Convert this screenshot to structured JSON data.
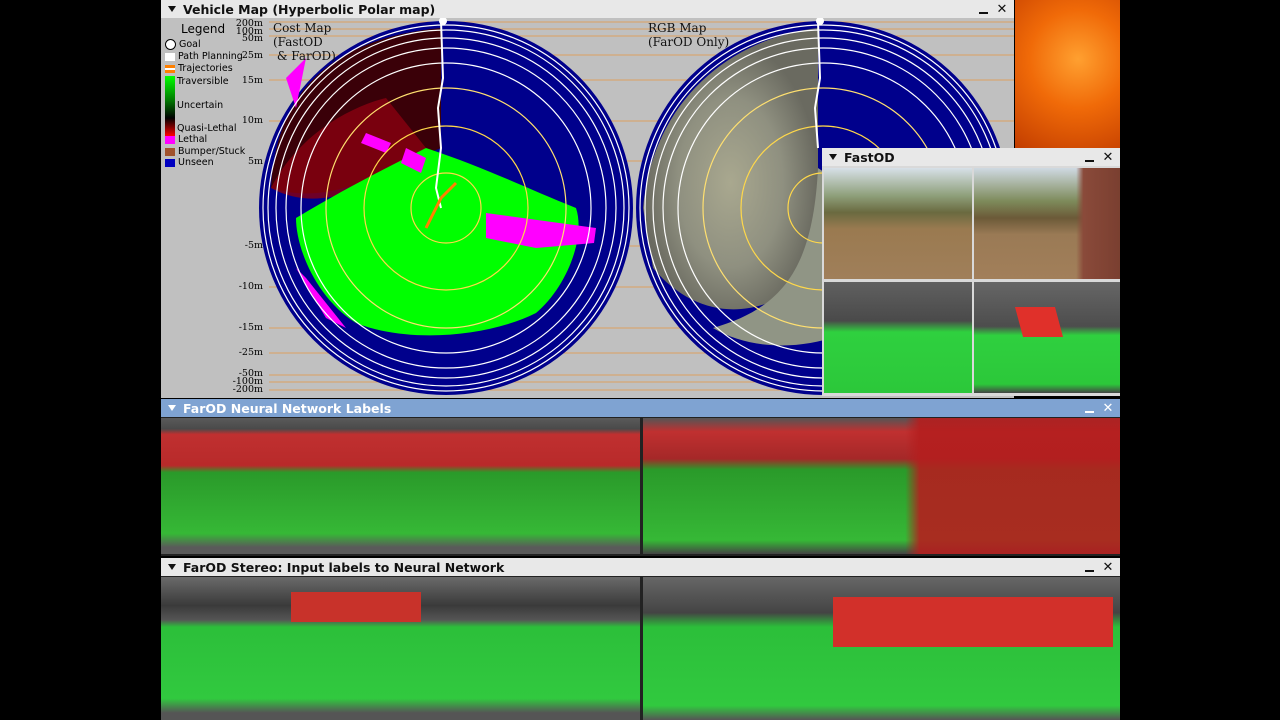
{
  "vehicle_map": {
    "title": "Vehicle Map (Hyperbolic Polar map)",
    "cost_map_label": "Cost Map\n(FastOD\n & FarOD)",
    "rgb_map_label": "RGB Map\n(FarOD Only)",
    "range_labels_top": [
      "200m",
      "100m",
      "50m",
      "25m",
      "15m",
      "10m",
      "5m"
    ],
    "range_labels_bottom": [
      "-5m",
      "-10m",
      "-15m",
      "-25m",
      "-50m",
      "-100m",
      "-200m"
    ],
    "legend": {
      "heading": "Legend",
      "items": [
        {
          "label": "Goal",
          "color": "#ffffff"
        },
        {
          "label": "Path Planning",
          "color": "#ffffff"
        },
        {
          "label": "Trajectories",
          "color": "#ff8000"
        },
        {
          "label": "Traversible",
          "color": "#00ff00"
        },
        {
          "label": "Uncertain",
          "color": "#000000"
        },
        {
          "label": "Quasi-Lethal",
          "color": "#ff0000"
        },
        {
          "label": "Lethal",
          "color": "#ff00ff"
        },
        {
          "label": "Bumper/Stuck",
          "color": "#a0522d"
        },
        {
          "label": "Unseen",
          "color": "#0000c0"
        }
      ]
    }
  },
  "fastod": {
    "title": "FastOD"
  },
  "nn_labels": {
    "title": "FarOD Neural Network Labels"
  },
  "stereo": {
    "title": "FarOD Stereo: Input labels to Neural Network"
  },
  "colors": {
    "unseen": "#000090",
    "traversable": "#00f000",
    "lethal": "#ff00ff",
    "quasi_lethal": "#d00000",
    "title_blue": "#7fa3d2"
  }
}
